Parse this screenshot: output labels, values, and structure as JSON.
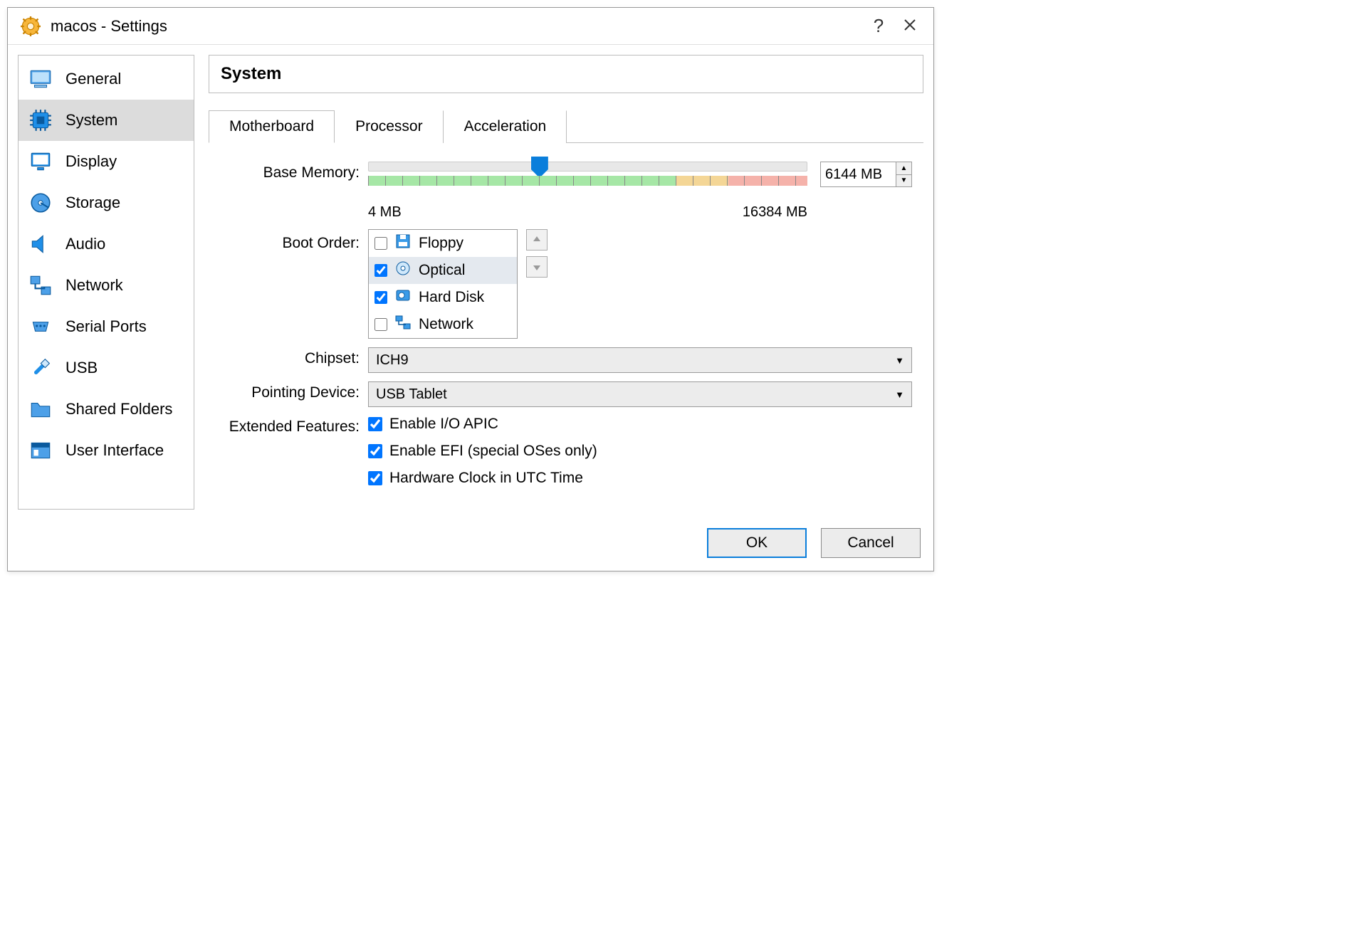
{
  "window": {
    "title": "macos - Settings"
  },
  "sidebar": {
    "items": [
      {
        "id": "general",
        "label": "General"
      },
      {
        "id": "system",
        "label": "System"
      },
      {
        "id": "display",
        "label": "Display"
      },
      {
        "id": "storage",
        "label": "Storage"
      },
      {
        "id": "audio",
        "label": "Audio"
      },
      {
        "id": "network",
        "label": "Network"
      },
      {
        "id": "serialports",
        "label": "Serial Ports"
      },
      {
        "id": "usb",
        "label": "USB"
      },
      {
        "id": "sharedfolders",
        "label": "Shared Folders"
      },
      {
        "id": "userinterface",
        "label": "User Interface"
      }
    ],
    "selected_index": 1
  },
  "page": {
    "title": "System"
  },
  "tabs": {
    "items": [
      "Motherboard",
      "Processor",
      "Acceleration"
    ],
    "active_index": 0
  },
  "motherboard": {
    "labels": {
      "base_memory": "Base Memory:",
      "boot_order": "Boot Order:",
      "chipset": "Chipset:",
      "pointing_device": "Pointing Device:",
      "extended_features": "Extended Features:",
      "memory_min": "4 MB",
      "memory_max": "16384 MB"
    },
    "memory": {
      "value_text": "6144 MB",
      "value": 6144,
      "min": 4,
      "max": 16384
    },
    "boot_order": [
      {
        "label": "Floppy",
        "checked": false,
        "selected": false
      },
      {
        "label": "Optical",
        "checked": true,
        "selected": true
      },
      {
        "label": "Hard Disk",
        "checked": true,
        "selected": false
      },
      {
        "label": "Network",
        "checked": false,
        "selected": false
      }
    ],
    "chipset": {
      "value": "ICH9"
    },
    "pointing_device": {
      "value": "USB Tablet"
    },
    "extended_features": {
      "apic": {
        "label": "Enable I/O APIC",
        "checked": true
      },
      "efi": {
        "label": "Enable EFI (special OSes only)",
        "checked": true
      },
      "utc": {
        "label": "Hardware Clock in UTC Time",
        "checked": true
      }
    }
  },
  "footer": {
    "ok": "OK",
    "cancel": "Cancel"
  }
}
